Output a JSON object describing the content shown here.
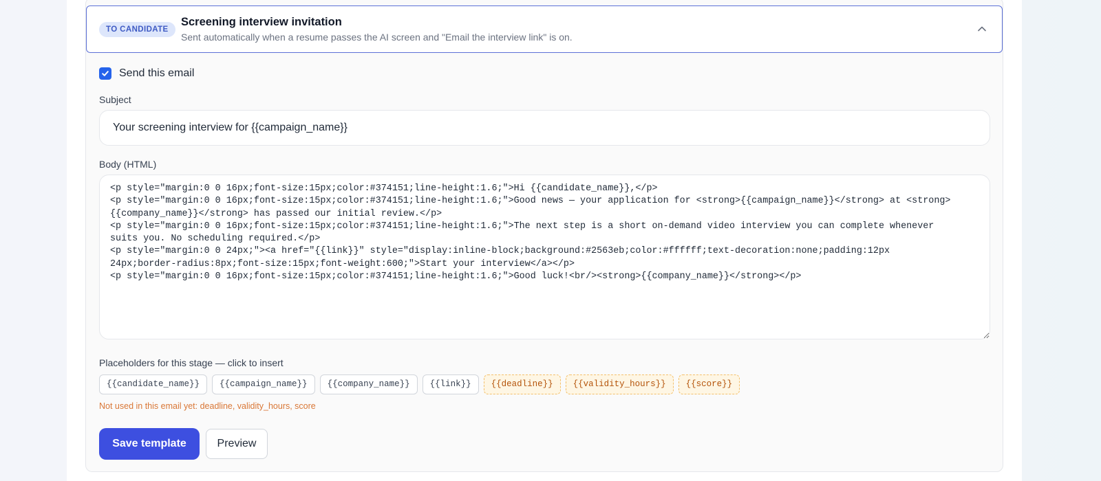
{
  "header": {
    "badge": "TO CANDIDATE",
    "title": "Screening interview invitation",
    "description": "Sent automatically when a resume passes the AI screen and \"Email the interview link\" is on."
  },
  "send_email": {
    "checked": true,
    "label": "Send this email"
  },
  "subject": {
    "label": "Subject",
    "value": "Your screening interview for {{campaign_name}}"
  },
  "body": {
    "label": "Body (HTML)",
    "value": "<p style=\"margin:0 0 16px;font-size:15px;color:#374151;line-height:1.6;\">Hi {{candidate_name}},</p>\n<p style=\"margin:0 0 16px;font-size:15px;color:#374151;line-height:1.6;\">Good news — your application for <strong>{{campaign_name}}</strong> at <strong>\n{{company_name}}</strong> has passed our initial review.</p>\n<p style=\"margin:0 0 16px;font-size:15px;color:#374151;line-height:1.6;\">The next step is a short on-demand video interview you can complete whenever\nsuits you. No scheduling required.</p>\n<p style=\"margin:0 0 24px;\"><a href=\"{{link}}\" style=\"display:inline-block;background:#2563eb;color:#ffffff;text-decoration:none;padding:12px\n24px;border-radius:8px;font-size:15px;font-weight:600;\">Start your interview</a></p>\n<p style=\"margin:0 0 16px;font-size:15px;color:#374151;line-height:1.6;\">Good luck!<br/><strong>{{company_name}}</strong></p>"
  },
  "placeholders": {
    "label": "Placeholders for this stage — click to insert",
    "used": [
      "{{candidate_name}}",
      "{{campaign_name}}",
      "{{company_name}}",
      "{{link}}"
    ],
    "unused": [
      "{{deadline}}",
      "{{validity_hours}}",
      "{{score}}"
    ],
    "unused_note": "Not used in this email yet: deadline, validity_hours, score"
  },
  "actions": {
    "save_label": "Save template",
    "preview_label": "Preview"
  },
  "colors": {
    "accent": "#3d4fe0",
    "checkbox": "#2563eb",
    "badge_bg": "#dde6fb",
    "badge_text": "#3f5bc4",
    "warning": "#d97736"
  }
}
